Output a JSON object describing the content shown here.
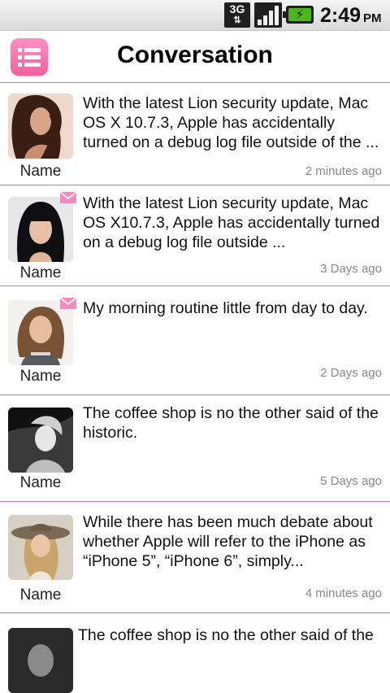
{
  "status_bar": {
    "network": "3G",
    "time": "2:49",
    "ampm": "PM",
    "icons": [
      "network-3g-icon",
      "signal-icon",
      "battery-charging-icon"
    ]
  },
  "header": {
    "title": "Conversation",
    "menu_icon": "list-menu-icon",
    "accent_color": "#f06aa8"
  },
  "conversations": [
    {
      "name": "Name",
      "message": "With the latest Lion security update, Mac OS X 10.7.3, Apple has accidentally turned on a debug log file outside of the ...",
      "time": "2 minutes ago",
      "unread": false
    },
    {
      "name": "Name",
      "message": "With the latest Lion security update, Mac OS X10.7.3, Apple has accidentally turned on a debug log file outside ...",
      "time": "3 Days ago",
      "unread": true
    },
    {
      "name": "Name",
      "message": "My morning routine little from day to day.",
      "time": "2 Days ago",
      "unread": true
    },
    {
      "name": "Name",
      "message": "The coffee shop is no the other said of the historic.",
      "time": "5 Days ago",
      "unread": false
    },
    {
      "name": "Name",
      "message": "While there has been much debate about whether Apple will refer to the iPhone as “iPhone 5”, “iPhone 6”, simply...",
      "time": "4 minutes ago",
      "unread": false
    },
    {
      "name": "",
      "message": "The coffee shop is no the other said of the",
      "time": "",
      "unread": false
    }
  ]
}
